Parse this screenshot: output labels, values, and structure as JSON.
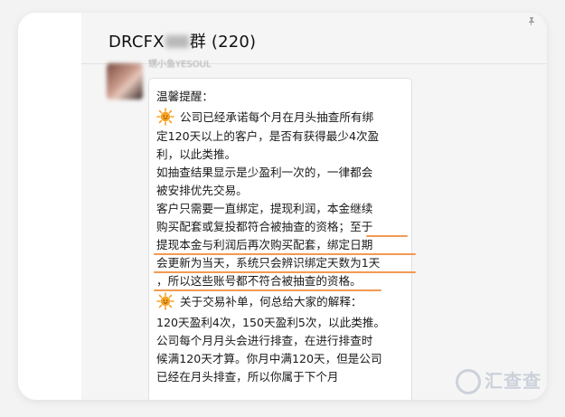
{
  "chat": {
    "title_prefix": "DRCFX",
    "title_suffix": "群 (220)",
    "sender_name": "甥小鱼YESOUL"
  },
  "message": {
    "lines": [
      "温馨提醒：",
      "公司已经承诺每个月在月头抽查所有绑",
      "定120天以上的客户，是否有获得最少4次盈",
      "利，以此类推。",
      "如抽查结果显示是少盈利一次的，一律都会",
      "被安排优先交易。",
      "客户只需要一直绑定，提现利润，本金继续",
      "购买配套或复投都符合被抽查的资格；至于",
      "提现本金与利润后再次购买配套，绑定日期",
      "会更新为当天，系统只会辨识绑定天数为1天",
      "，所以这些账号都不符合被抽查的资格。",
      "关于交易补单，何总给大家的解释：",
      "120天盈利4次，150天盈利5次，以此类推。",
      "公司每个月月头会进行排查，在进行排查时",
      "候满120天才算。你月中满120天，但是公司",
      "已经在月头排查，所以你属于下个月"
    ]
  },
  "watermark": {
    "text": "汇查查"
  },
  "colors": {
    "underline": "#f29a55",
    "sun": "#f7a325"
  }
}
